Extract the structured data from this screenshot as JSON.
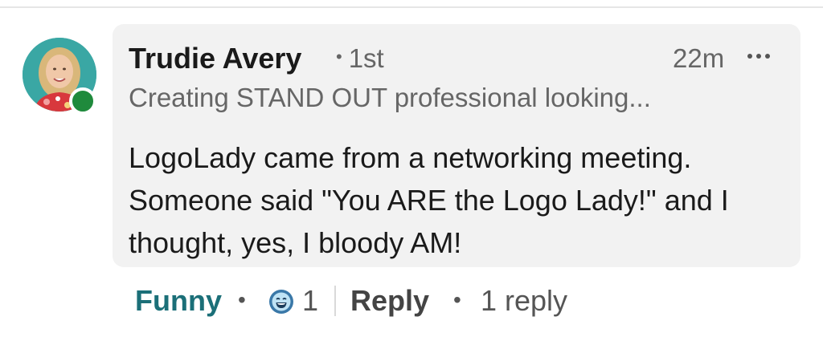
{
  "comment": {
    "author": {
      "name": "Trudie Avery",
      "connection_degree": "1st",
      "headline": "Creating STAND OUT professional looking...",
      "online_status_color": "#1f8a3c"
    },
    "timestamp": "22m",
    "body": "LogoLady came from a networking meeting. Someone said \"You ARE the Logo Lady!\" and I thought, yes, I bloody AM!"
  },
  "actions": {
    "reaction_label": "Funny",
    "reaction_icon": "laughing-face-icon",
    "reaction_count": "1",
    "reply_label": "Reply",
    "replies_count_label": "1 reply"
  },
  "colors": {
    "accent": "#1b6f78",
    "bubble_background": "#f2f2f2"
  }
}
